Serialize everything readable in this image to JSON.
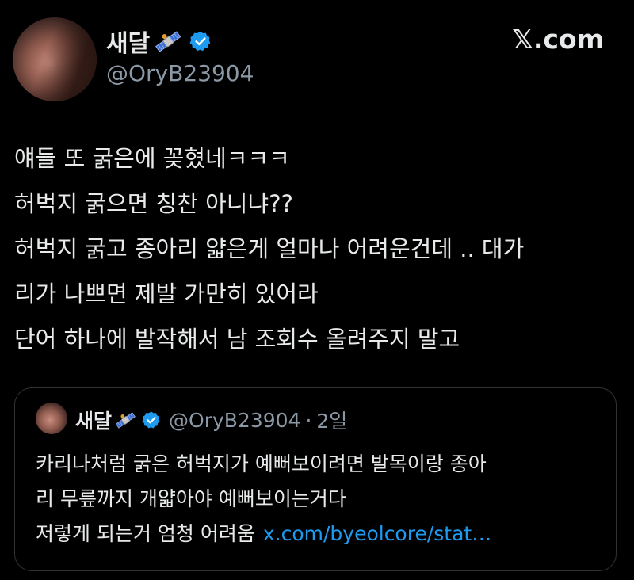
{
  "author": {
    "display_name": "새달",
    "handle": "@OryB23904",
    "badge_icon": "satellite-icon",
    "verified_icon": "verified-badge-icon"
  },
  "site_label": "𝕏.com",
  "tweet_lines": [
    "얘들 또 굵은에 꽂혔네ㅋㅋㅋ",
    "허벅지 굵으면 칭찬 아니냐??",
    "허벅지 굵고 종아리 얇은게 얼마나 어려운건데 .. 대가",
    "리가 나쁘면 제발 가만히 있어라",
    "단어 하나에 발작해서 남 조회수 올려주지 말고"
  ],
  "quoted": {
    "display_name": "새달",
    "handle": "@OryB23904",
    "separator": "·",
    "time": "2일",
    "lines": [
      "카리나처럼 굵은 허벅지가 예뻐보이려면 발목이랑 종아",
      "리 무릎까지  개얇아야  예뻐보이는거다",
      " 저렇게 되는거 엄청 어려움"
    ],
    "link": "x.com/byeolcore/stat…"
  },
  "colors": {
    "background": "#000000",
    "text": "#e7e9ea",
    "muted": "#8b98a5",
    "link": "#1d9bf0",
    "verified": "#1d9bf0",
    "border": "#2f3336"
  }
}
